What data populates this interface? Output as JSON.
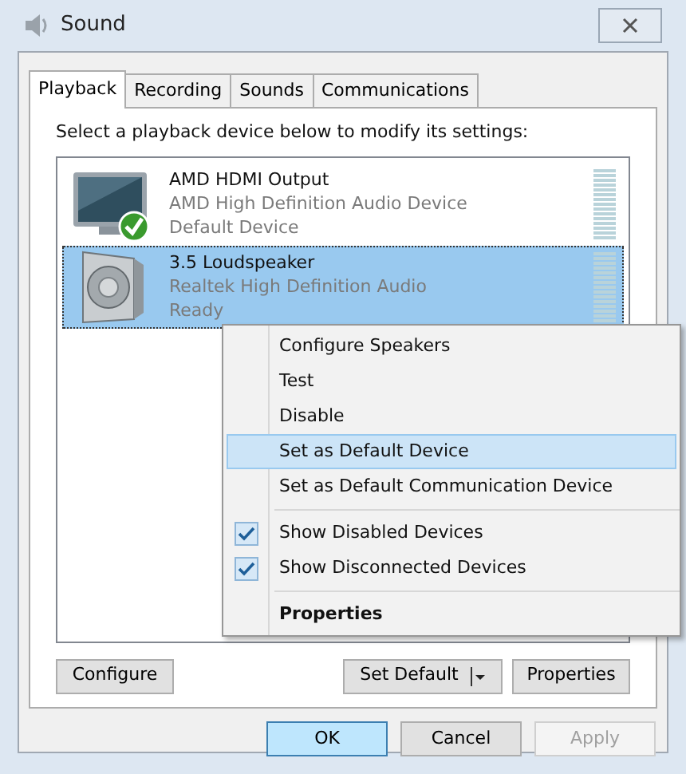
{
  "window": {
    "title": "Sound"
  },
  "tabs": [
    {
      "label": "Playback",
      "selected": true
    },
    {
      "label": "Recording",
      "selected": false
    },
    {
      "label": "Sounds",
      "selected": false
    },
    {
      "label": "Communications",
      "selected": false
    }
  ],
  "instruction": "Select a playback device below to modify its settings:",
  "devices": [
    {
      "kind": "monitor",
      "name": "AMD HDMI Output",
      "driver": "AMD High Definition Audio Device",
      "status": "Default Device",
      "is_default": true,
      "selected": false
    },
    {
      "kind": "speaker",
      "name": "3.5 Loudspeaker",
      "driver": "Realtek High Definition Audio",
      "status": "Ready",
      "is_default": false,
      "selected": true
    }
  ],
  "context_menu": [
    {
      "kind": "item",
      "label": "Configure Speakers",
      "selected": false,
      "checked": false,
      "bold": false
    },
    {
      "kind": "item",
      "label": "Test",
      "selected": false,
      "checked": false,
      "bold": false
    },
    {
      "kind": "item",
      "label": "Disable",
      "selected": false,
      "checked": false,
      "bold": false
    },
    {
      "kind": "item",
      "label": "Set as Default Device",
      "selected": true,
      "checked": false,
      "bold": false
    },
    {
      "kind": "item",
      "label": "Set as Default Communication Device",
      "selected": false,
      "checked": false,
      "bold": false
    },
    {
      "kind": "separator"
    },
    {
      "kind": "item",
      "label": "Show Disabled Devices",
      "selected": false,
      "checked": true,
      "bold": false
    },
    {
      "kind": "item",
      "label": "Show Disconnected Devices",
      "selected": false,
      "checked": true,
      "bold": false
    },
    {
      "kind": "separator"
    },
    {
      "kind": "item",
      "label": "Properties",
      "selected": false,
      "checked": false,
      "bold": true
    }
  ],
  "panel_buttons": {
    "configure": {
      "label": "Configure"
    },
    "set_default": {
      "label": "Set Default"
    },
    "properties": {
      "label": "Properties"
    }
  },
  "dialog_buttons": [
    {
      "label": "OK",
      "kind": "primary",
      "disabled": false
    },
    {
      "label": "Cancel",
      "kind": "normal",
      "disabled": false
    },
    {
      "label": "Apply",
      "kind": "normal",
      "disabled": true
    }
  ]
}
